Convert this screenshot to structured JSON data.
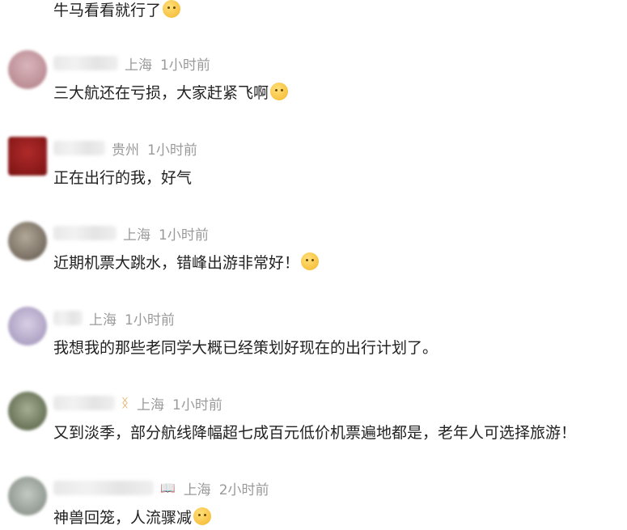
{
  "comments": [
    {
      "location": "",
      "time": "",
      "text": "牛马看看就行了",
      "emoji": "smirk-face-icon",
      "avatar_color": "#ffffff"
    },
    {
      "location": "上海",
      "time": "1小时前",
      "text": "三大航还在亏损，大家赶紧飞啊",
      "emoji": "exploding-head-icon",
      "avatar_color": "#c9a0a8"
    },
    {
      "location": "贵州",
      "time": "1小时前",
      "text": "正在出行的我，好气",
      "emoji": "",
      "avatar_color": "#8b1c1c"
    },
    {
      "location": "上海",
      "time": "1小时前",
      "text": "近期机票大跳水，错峰出游非常好！",
      "emoji": "hug-face-icon",
      "avatar_color": "#8a7f72"
    },
    {
      "location": "上海",
      "time": "1小时前",
      "text": "我想我的那些老同学大概已经策划好现在的出行计划了。",
      "emoji": "",
      "avatar_color": "#b4a7c9"
    },
    {
      "location": "上海",
      "time": "1小时前",
      "text": "又到淡季，部分航线降幅超七成百元低价机票遍地都是，老年人可选择旅游！",
      "emoji": "",
      "avatar_color": "#6f7a5e",
      "badge": "ᛝ"
    },
    {
      "location": "上海",
      "time": "2小时前",
      "text": "神兽回笼，人流骤减",
      "emoji": "laugh-tears-icon",
      "avatar_color": "#9aa39b",
      "badge": "📖"
    }
  ]
}
